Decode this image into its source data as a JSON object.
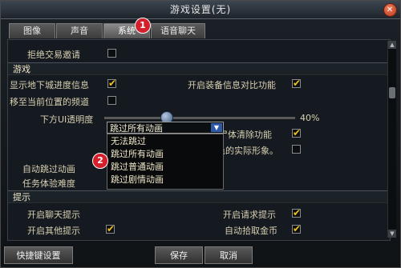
{
  "window": {
    "title": "游戏设置(无)",
    "close_label": "✕"
  },
  "tabs": [
    {
      "label": "图像"
    },
    {
      "label": "声音"
    },
    {
      "label": "系统"
    },
    {
      "label": "语音聊天"
    }
  ],
  "badges": {
    "one": "1",
    "two": "2"
  },
  "rows": {
    "reject_trade": {
      "label": "拒绝交易邀请",
      "checked": false
    },
    "game_section": "游戏",
    "show_dungeon": {
      "label": "显示地下城进度信息",
      "checked": true
    },
    "equip_compare": {
      "label": "开启装备信息对比功能",
      "checked": true
    },
    "move_channel": {
      "label": "移至当前位置的频道",
      "checked": false
    },
    "ui_opacity": {
      "label": "下方UI透明度",
      "value": "40%",
      "level": 0.3
    },
    "corpse_clear": {
      "label": "开启攻击死亡怪物时尸体清除功能",
      "checked": true
    },
    "show_appearance": {
      "label": "在城镇中移动时显示其他角色的实际形象。",
      "checked": false
    },
    "auto_skip": {
      "label": "自动跳过动画",
      "selected": "跳过所有动画"
    },
    "task_difficulty": {
      "label": "任务体验难度"
    },
    "tips_section": "提示",
    "chat_tip": {
      "label": "开启聊天提示"
    },
    "request_tip": {
      "label": "开启请求提示",
      "checked": true
    },
    "other_tip": {
      "label": "开启其他提示",
      "checked": true
    },
    "auto_gold": {
      "label": "自动拾取金币",
      "checked": true
    }
  },
  "dropdown_options": [
    "无法跳过",
    "跳过所有动画",
    "跳过普通动画",
    "跳过剧情动画"
  ],
  "buttons": {
    "shortcut": "快捷键设置",
    "save": "保存",
    "cancel": "取消"
  }
}
